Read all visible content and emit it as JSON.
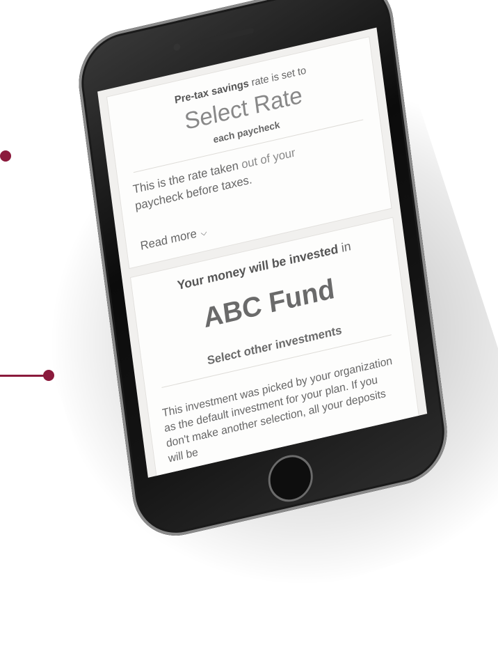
{
  "colors": {
    "accent": "#8b1a3c"
  },
  "rate_card": {
    "intro_bold": "Pre-tax savings",
    "intro_rest": " rate is set to",
    "rate": "Select Rate",
    "frequency": "each paycheck",
    "desc_a": "This is the rate taken ",
    "desc_b": "out of your",
    "desc_c": "paycheck before taxes.",
    "read_more": "Read more",
    "read_more_icon": "chevron-down"
  },
  "invest_card": {
    "intro_bold": "Your money will be invested",
    "intro_rest": " in",
    "fund": "ABC Fund",
    "select_other": "Select other investments",
    "desc": "This investment was picked by your organization as the default investment for your plan. If you don't make another selection, all your deposits will be"
  }
}
